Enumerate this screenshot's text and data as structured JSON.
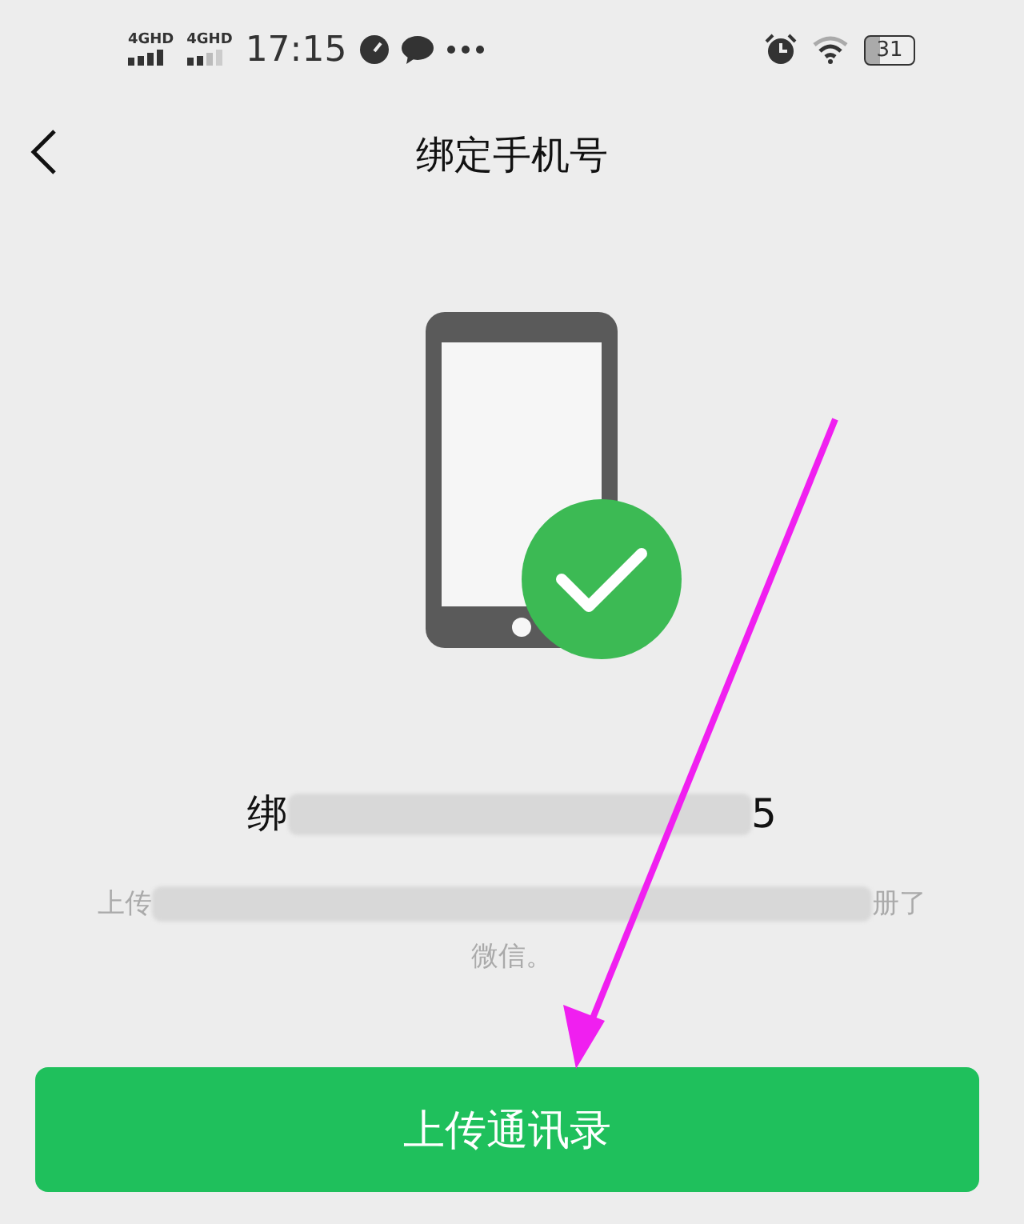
{
  "status_bar": {
    "networks": [
      "4GHD",
      "4GHD"
    ],
    "time": "17:15",
    "battery": "31"
  },
  "nav": {
    "title": "绑定手机号"
  },
  "bound_number": {
    "visible_start": "绑",
    "visible_end": "5"
  },
  "description": {
    "line_1_start": "上传",
    "line_1_end": "册了",
    "line_2": "微信。"
  },
  "button": {
    "label": "上传通讯录"
  }
}
